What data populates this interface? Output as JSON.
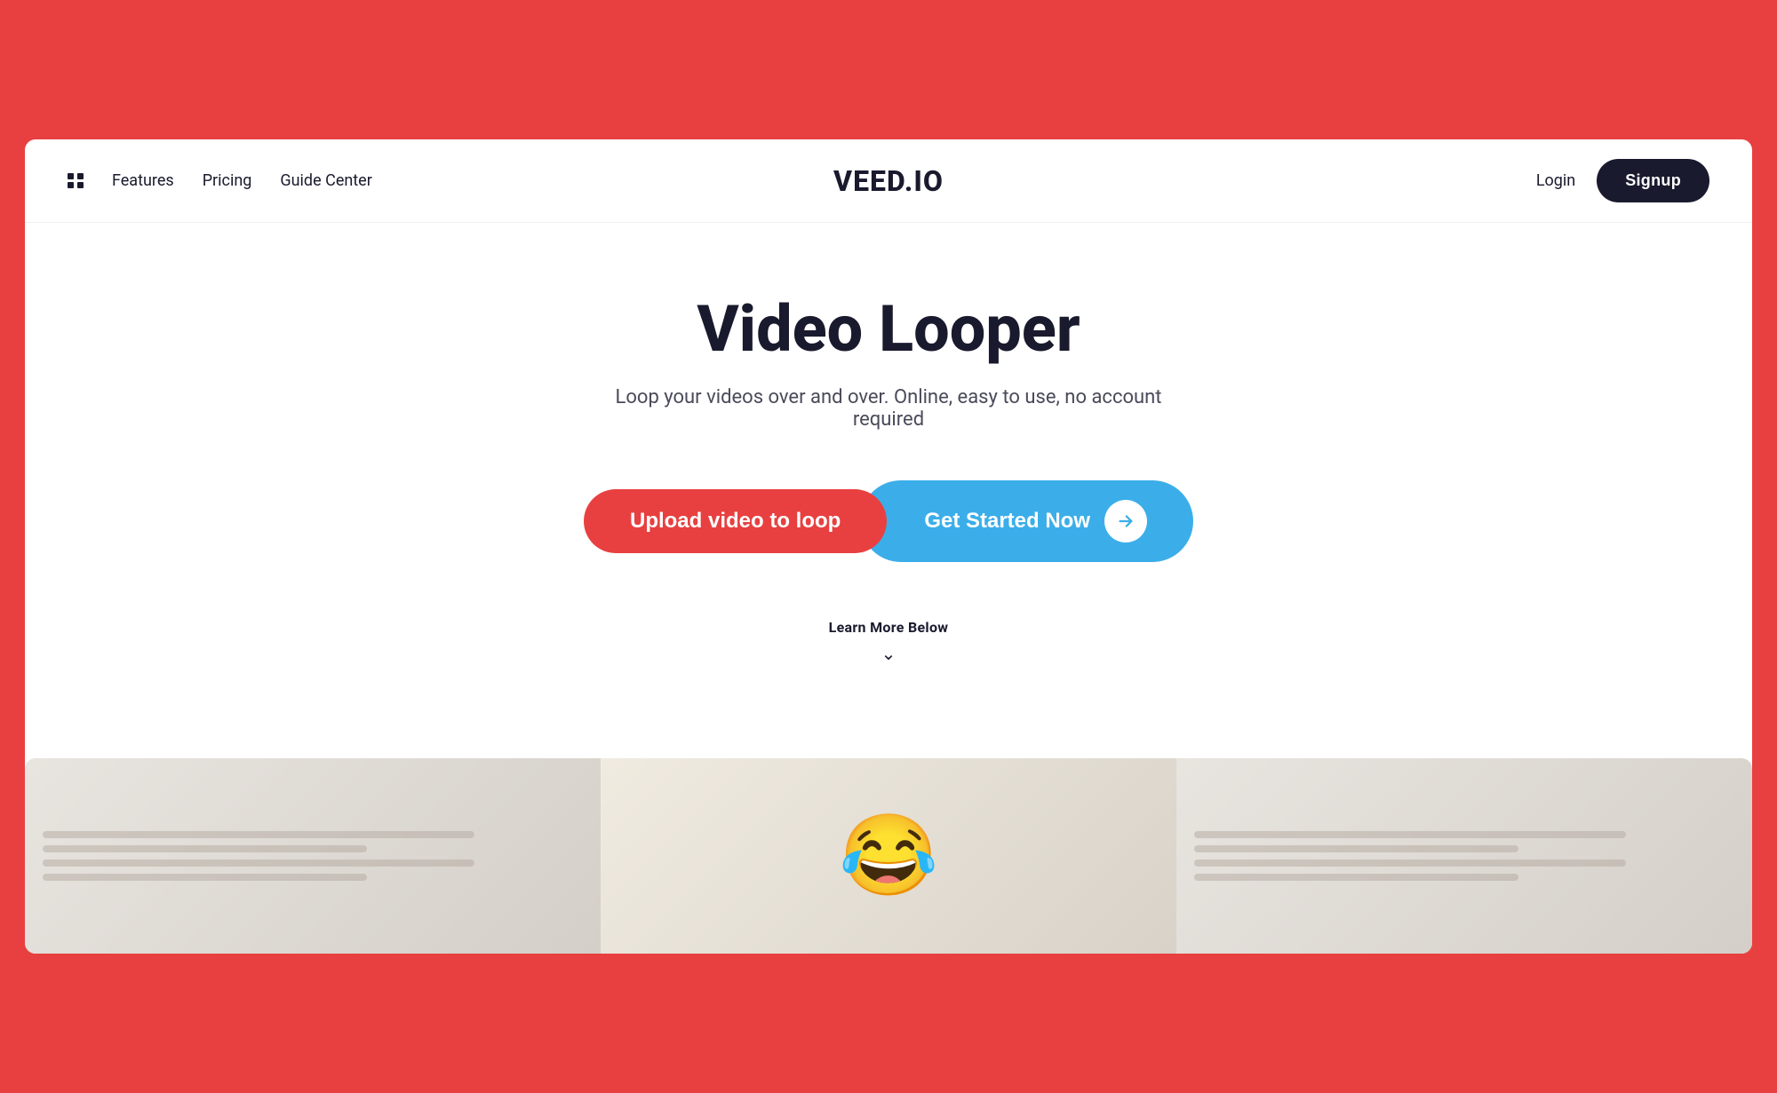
{
  "brand": {
    "name": "VEED.IO",
    "background_color": "#e84040",
    "dark_color": "#1a1a2e"
  },
  "navbar": {
    "grid_icon_label": "menu",
    "links": [
      {
        "id": "features",
        "label": "Features"
      },
      {
        "id": "pricing",
        "label": "Pricing"
      },
      {
        "id": "guide-center",
        "label": "Guide Center"
      }
    ],
    "login_label": "Login",
    "signup_label": "Signup"
  },
  "hero": {
    "title": "Video Looper",
    "subtitle": "Loop your videos over and over. Online, easy to use, no account required",
    "upload_button_label": "Upload video to loop",
    "get_started_label": "Get Started Now",
    "learn_more_label": "Learn More Below",
    "arrow_icon": "→"
  },
  "thumbnails": [
    {
      "id": "left",
      "type": "lines"
    },
    {
      "id": "center",
      "type": "emoji",
      "content": "😂"
    },
    {
      "id": "right",
      "type": "lines"
    }
  ]
}
